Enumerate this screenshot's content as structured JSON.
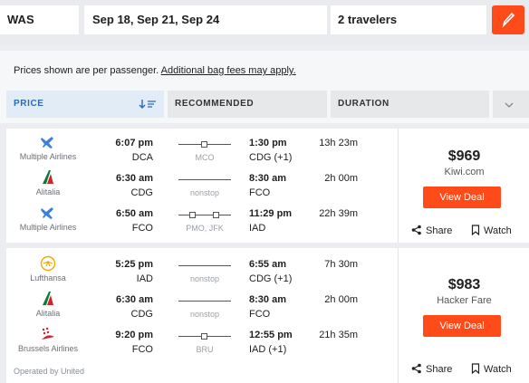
{
  "search": {
    "origin": "WAS",
    "dates": "Sep 18, Sep 21, Sep 24",
    "travelers": "2 travelers"
  },
  "notice": {
    "text": "Prices shown are per passenger.",
    "link": "Additional bag fees may apply."
  },
  "sort": {
    "price": "PRICE",
    "recommended": "RECOMMENDED",
    "duration": "DURATION"
  },
  "colors": {
    "accent": "#ff4a1a",
    "active_sort_text": "#2a6bb8",
    "active_sort_bg": "#e1ecf7"
  },
  "results": [
    {
      "legs": [
        {
          "airline": "Multiple Airlines",
          "logo": "plane-icon",
          "dep_time": "6:07 pm",
          "dep_code": "DCA",
          "route": "MCO",
          "arr_time": "1:30 pm",
          "arr_code": "CDG (+1)",
          "duration": "13h 23m"
        },
        {
          "airline": "Alitalia",
          "logo": "alitalia-logo",
          "dep_time": "6:30 am",
          "dep_code": "CDG",
          "route": "nonstop",
          "arr_time": "8:30 am",
          "arr_code": "FCO",
          "duration": "2h 00m"
        },
        {
          "airline": "Multiple Airlines",
          "logo": "plane-icon",
          "dep_time": "6:50 am",
          "dep_code": "FCO",
          "route": "PMO, JFK",
          "arr_time": "11:29 pm",
          "arr_code": "IAD",
          "duration": "22h 39m"
        }
      ],
      "price": "$969",
      "provider": "Kiwi.com",
      "cta": "View Deal",
      "share": "Share",
      "watch": "Watch"
    },
    {
      "legs": [
        {
          "airline": "Lufthansa",
          "logo": "lufthansa-logo",
          "dep_time": "5:25 pm",
          "dep_code": "IAD",
          "route": "nonstop",
          "arr_time": "6:55 am",
          "arr_code": "CDG (+1)",
          "duration": "7h 30m"
        },
        {
          "airline": "Alitalia",
          "logo": "alitalia-logo",
          "dep_time": "6:30 am",
          "dep_code": "CDG",
          "route": "nonstop",
          "arr_time": "8:30 am",
          "arr_code": "FCO",
          "duration": "2h 00m"
        },
        {
          "airline": "Brussels Airlines",
          "logo": "brussels-airlines-logo",
          "dep_time": "9:20 pm",
          "dep_code": "FCO",
          "route": "BRU",
          "arr_time": "12:55 pm",
          "arr_code": "IAD (+1)",
          "duration": "21h 35m"
        }
      ],
      "operated": "Operated by United",
      "price": "$983",
      "provider": "Hacker Fare",
      "cta": "View Deal",
      "share": "Share",
      "watch": "Watch"
    }
  ]
}
